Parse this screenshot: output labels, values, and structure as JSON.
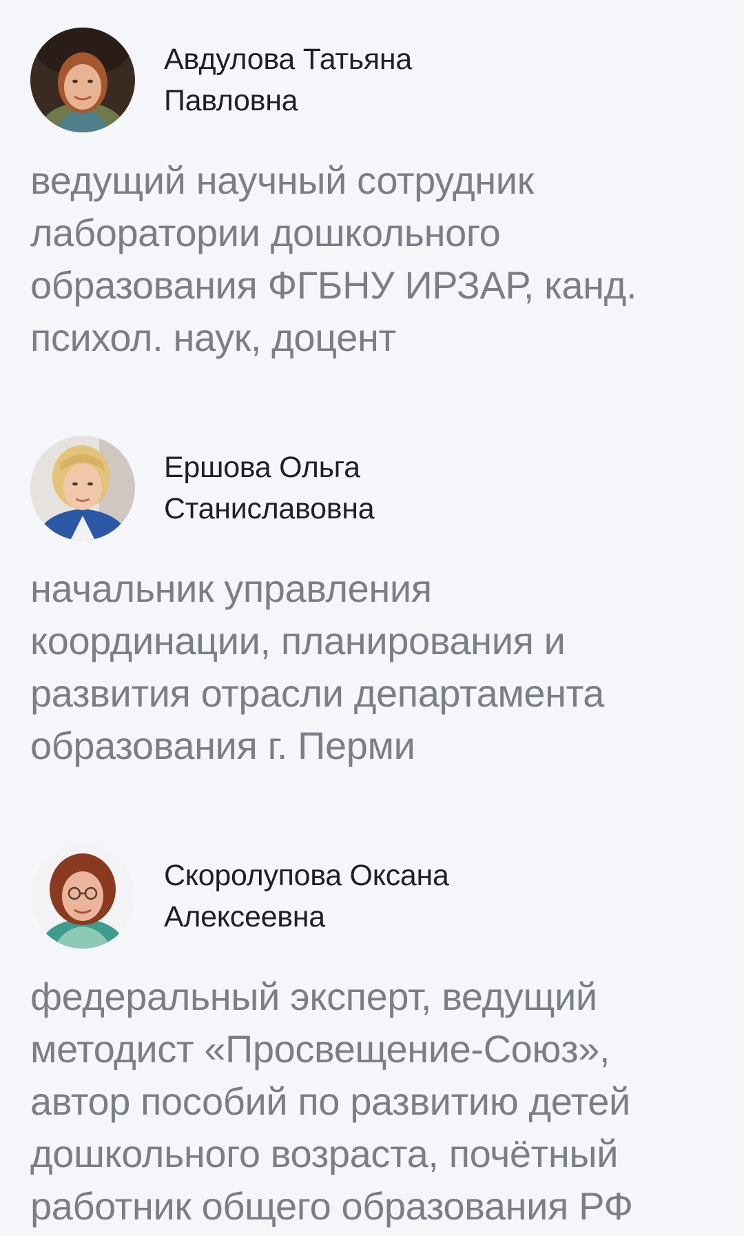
{
  "experts": [
    {
      "avatar_icon": "portrait-woman-red-hair",
      "name_lines": [
        "Авдулова Татьяна",
        "Павловна"
      ],
      "role_lines": [
        "ведущий научный сотрудник",
        "лаборатории дошкольного",
        "образования ФГБНУ ИРЗАР, канд.",
        "психол. наук, доцент"
      ]
    },
    {
      "avatar_icon": "portrait-woman-blonde",
      "name_lines": [
        "Ершова Ольга",
        "Станиславовна"
      ],
      "role_lines": [
        "начальник управления",
        "координации, планирования и",
        "развития отрасли департамента",
        "образования г. Перми"
      ]
    },
    {
      "avatar_icon": "portrait-woman-glasses",
      "name_lines": [
        "Скоролупова Оксана",
        "Алексеевна"
      ],
      "role_lines": [
        "федеральный эксперт, ведущий",
        "методист «Просвещение-Союз»,",
        "автор пособий по развитию детей",
        "дошкольного возраста, почётный",
        "работник общего образования РФ"
      ]
    }
  ]
}
